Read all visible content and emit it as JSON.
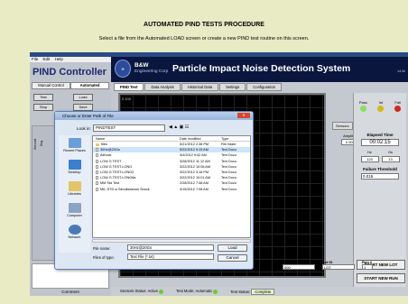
{
  "page": {
    "title": "AUTOMATED PIND TESTS PROCEDURE",
    "subtitle": "Select a file from the Automated LOAD screen or create a new PIND test routine on this screen."
  },
  "app": {
    "menu": [
      "File",
      "Edit",
      "Help"
    ],
    "controller_title": "PIND Controller",
    "left_tabs": [
      "Manual Control",
      "Automated"
    ],
    "buttons": {
      "test": "Test",
      "load": "Load",
      "stop": "Stop",
      "save": "Save"
    },
    "left_labels": {
      "second": "Second",
      "seq": "Seq",
      "comment": "Comment"
    },
    "brand": {
      "name": "B&W",
      "sub": "Engineering Corp",
      "version": "v4.0e"
    },
    "system_title": "Particle Impact Noise Detection System",
    "tabs": [
      "PIND Test",
      "Data Analysis",
      "Historical Data",
      "Settings",
      "Configuration"
    ],
    "chart_top_label": "0.100",
    "sensors_label": "Sensors",
    "amplitude": {
      "label": "Amplitude",
      "index": "1",
      "value": "0.0004"
    },
    "pif": {
      "pass": "Pass",
      "int": "Int",
      "fail": "Fail"
    },
    "pif_colors": {
      "pass": "#8adf5a",
      "int": "#d4b818",
      "fail": "#cc2a1a"
    },
    "elapsed": {
      "label": "Elapsed Time",
      "value": "00:02:15"
    },
    "hz": {
      "hz_label": "Hz",
      "gs_label": "Gs",
      "hz": "120",
      "gs": "13"
    },
    "threshold": {
      "label": "Failure Threshold",
      "value": "0.015"
    },
    "fields": {
      "unit_label": "UNIT S/N",
      "unit_value": "000",
      "lot_label": "Lot ID",
      "lot_value": "LOT",
      "run_label": "Run #",
      "run_value": "1"
    },
    "start_lot": "START NEW LOT",
    "start_run": "START NEW RUN",
    "status": {
      "sensors": "Sensors Status: Active",
      "mode": "Test Mode: Automatic",
      "test_status_label": "Test Status:",
      "test_status": "Complete"
    }
  },
  "dialog": {
    "title": "Choose or Enter Path of File",
    "look_in_label": "Look in:",
    "look_in_value": "PINDTEST",
    "places": [
      "Recent Places",
      "Desktop",
      "Libraries",
      "Computer",
      "Network"
    ],
    "headers": {
      "name": "Name",
      "date": "Date modified",
      "type": "Type"
    },
    "rows": [
      {
        "name": "files",
        "date": "5/21/2012 2:38 PM",
        "type": "File folder",
        "folder": true
      },
      {
        "name": "30Hz@20Gs",
        "date": "5/22/2012 9:19 AM",
        "type": "Text Docu",
        "sel": true
      },
      {
        "name": "Ashock",
        "date": "3/4/2012 9:42 AM",
        "type": "Text Docu"
      },
      {
        "name": "LOW G TEST",
        "date": "3/28/2012 11:12 AM",
        "type": "Text Docu"
      },
      {
        "name": "LOW G TEST-LONG",
        "date": "3/22/2012 10:08 AM",
        "type": "Text Docu"
      },
      {
        "name": "LOW G TEST-LONG2",
        "date": "3/22/2012 3:18 PM",
        "type": "Text Docu"
      },
      {
        "name": "LOW G TEST-LONG6a",
        "date": "3/22/2012 10:01 AM",
        "type": "Text Docu"
      },
      {
        "name": "MM Std Test",
        "date": "2/28/2012 7:48 AM",
        "type": "Text Docu"
      },
      {
        "name": "MIL-STD w Simultaneous Shock",
        "date": "4/15/2012 7:08 AM",
        "type": "Text Docu"
      }
    ],
    "file_name_label": "File name:",
    "file_name_value": "30Hz@20Gs",
    "file_type_label": "Files of type:",
    "file_type_value": "Text File (*.txt)",
    "load": "Load",
    "cancel": "Cancel"
  }
}
